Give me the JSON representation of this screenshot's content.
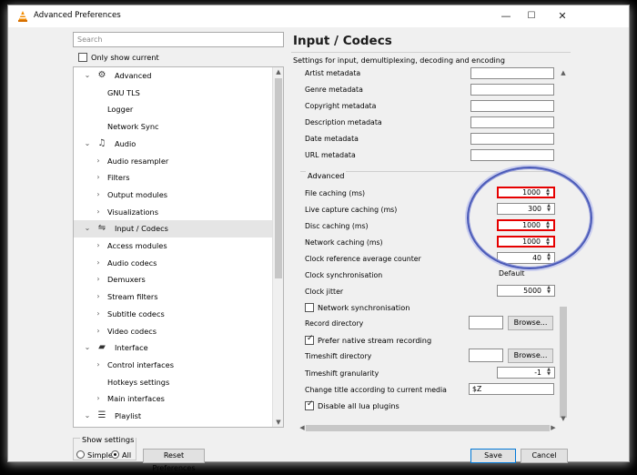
{
  "window": {
    "title": "Advanced Preferences",
    "controls": {
      "minimize": "—",
      "maximize": "☐",
      "close": "✕"
    }
  },
  "left": {
    "search_placeholder": "Search",
    "only_show_current": "Only show current",
    "tree": [
      {
        "label": "Advanced",
        "level": 0,
        "expanded": true,
        "icon": "gear-icon"
      },
      {
        "label": "GNU TLS",
        "level": 1
      },
      {
        "label": "Logger",
        "level": 1
      },
      {
        "label": "Network Sync",
        "level": 1
      },
      {
        "label": "Audio",
        "level": 0,
        "expanded": true,
        "icon": "music-note-icon"
      },
      {
        "label": "Audio resampler",
        "level": 1,
        "collapsed": true
      },
      {
        "label": "Filters",
        "level": 1,
        "collapsed": true
      },
      {
        "label": "Output modules",
        "level": 1,
        "collapsed": true
      },
      {
        "label": "Visualizations",
        "level": 1,
        "collapsed": true
      },
      {
        "label": "Input / Codecs",
        "level": 0,
        "expanded": true,
        "icon": "input-codecs-icon",
        "selected": true
      },
      {
        "label": "Access modules",
        "level": 1,
        "collapsed": true
      },
      {
        "label": "Audio codecs",
        "level": 1,
        "collapsed": true
      },
      {
        "label": "Demuxers",
        "level": 1,
        "collapsed": true
      },
      {
        "label": "Stream filters",
        "level": 1,
        "collapsed": true
      },
      {
        "label": "Subtitle codecs",
        "level": 1,
        "collapsed": true
      },
      {
        "label": "Video codecs",
        "level": 1,
        "collapsed": true
      },
      {
        "label": "Interface",
        "level": 0,
        "expanded": true,
        "icon": "interface-icon"
      },
      {
        "label": "Control interfaces",
        "level": 1,
        "collapsed": true
      },
      {
        "label": "Hotkeys settings",
        "level": 1
      },
      {
        "label": "Main interfaces",
        "level": 1,
        "collapsed": true
      },
      {
        "label": "Playlist",
        "level": 0,
        "expanded": true,
        "icon": "playlist-icon"
      }
    ],
    "show_settings": {
      "label": "Show settings",
      "simple": "Simple",
      "all": "All",
      "selected": "All"
    },
    "reset_button": "Reset Preferences"
  },
  "right": {
    "title": "Input / Codecs",
    "description": "Settings for input, demultiplexing, decoding and encoding",
    "metadata_rows": [
      {
        "label": "Artist metadata",
        "value": ""
      },
      {
        "label": "Genre metadata",
        "value": ""
      },
      {
        "label": "Copyright metadata",
        "value": ""
      },
      {
        "label": "Description metadata",
        "value": ""
      },
      {
        "label": "Date metadata",
        "value": ""
      },
      {
        "label": "URL metadata",
        "value": ""
      }
    ],
    "advanced_group": "Advanced",
    "advanced_rows": [
      {
        "label": "File caching (ms)",
        "value": "1000",
        "highlight": true
      },
      {
        "label": "Live capture caching (ms)",
        "value": "300",
        "highlight": false
      },
      {
        "label": "Disc caching (ms)",
        "value": "1000",
        "highlight": true
      },
      {
        "label": "Network caching (ms)",
        "value": "1000",
        "highlight": true
      },
      {
        "label": "Clock reference average counter",
        "value": "40",
        "highlight": false
      }
    ],
    "clock_sync": {
      "label": "Clock synchronisation",
      "value": "Default"
    },
    "clock_jitter": {
      "label": "Clock jitter",
      "value": "5000"
    },
    "network_sync": {
      "label": "Network synchronisation",
      "checked": false
    },
    "record_directory": {
      "label": "Record directory",
      "value": "",
      "browse": "Browse..."
    },
    "prefer_native": {
      "label": "Prefer native stream recording",
      "checked": true
    },
    "timeshift_directory": {
      "label": "Timeshift directory",
      "value": "",
      "browse": "Browse..."
    },
    "timeshift_granularity": {
      "label": "Timeshift granularity",
      "value": "-1"
    },
    "change_title": {
      "label": "Change title according to current media",
      "value": "$Z"
    },
    "disable_lua": {
      "label": "Disable all lua plugins",
      "checked": true
    }
  },
  "footer": {
    "save": "Save",
    "cancel": "Cancel"
  },
  "colors": {
    "highlight": "#e60000",
    "annotation_circle": "#4a5ab8",
    "selection": "#e5e5e5"
  }
}
